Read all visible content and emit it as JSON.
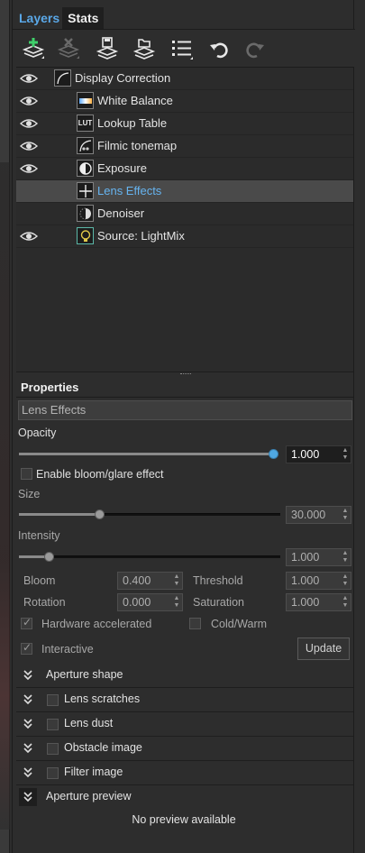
{
  "tabs": [
    {
      "label": "Layers"
    },
    {
      "label": "Stats"
    }
  ],
  "toolbar": {
    "icons": [
      "add-layer-icon",
      "delete-layer-icon",
      "save-icon",
      "open-folder-icon",
      "list-menu-icon",
      "undo-icon",
      "redo-icon"
    ]
  },
  "layers": [
    {
      "name": "Display Correction",
      "visible": true,
      "icon": "curve-icon"
    },
    {
      "name": "White Balance",
      "visible": true,
      "icon": "white-balance-icon"
    },
    {
      "name": "Lookup Table",
      "visible": true,
      "icon": "lut-icon",
      "icon_text": "LUT"
    },
    {
      "name": "Filmic tonemap",
      "visible": true,
      "icon": "filmic-icon"
    },
    {
      "name": "Exposure",
      "visible": true,
      "icon": "exposure-icon"
    },
    {
      "name": "Lens Effects",
      "visible": false,
      "icon": "lens-effects-icon",
      "selected": true
    },
    {
      "name": "Denoiser",
      "visible": false,
      "icon": "denoiser-icon"
    },
    {
      "name": "Source: LightMix",
      "visible": true,
      "icon": "lightmix-icon"
    }
  ],
  "properties": {
    "header": "Properties",
    "layer_name": "Lens Effects",
    "opacity": {
      "label": "Opacity",
      "value": "1.000",
      "fraction": 1.0
    },
    "enable_bloom": {
      "label": "Enable bloom/glare effect",
      "checked": false
    },
    "size": {
      "label": "Size",
      "value": "30.000",
      "fraction": 0.3
    },
    "intensity": {
      "label": "Intensity",
      "value": "1.000",
      "fraction": 0.1
    },
    "bloom": {
      "label": "Bloom",
      "value": "0.400"
    },
    "threshold": {
      "label": "Threshold",
      "value": "1.000"
    },
    "rotation": {
      "label": "Rotation",
      "value": "0.000"
    },
    "saturation": {
      "label": "Saturation",
      "value": "1.000"
    },
    "hardware_accelerated": {
      "label": "Hardware accelerated",
      "checked": true
    },
    "cold_warm": {
      "label": "Cold/Warm",
      "checked": false
    },
    "interactive": {
      "label": "Interactive",
      "checked": true
    },
    "update_button": "Update",
    "sections": [
      {
        "label": "Aperture shape",
        "has_checkbox": false
      },
      {
        "label": "Lens scratches",
        "has_checkbox": true
      },
      {
        "label": "Lens dust",
        "has_checkbox": true
      },
      {
        "label": "Obstacle image",
        "has_checkbox": true
      },
      {
        "label": "Filter image",
        "has_checkbox": true
      },
      {
        "label": "Aperture preview",
        "has_checkbox": false
      }
    ],
    "preview_text": "No preview available"
  },
  "colors": {
    "accent": "#4fa8e3",
    "selected_text": "#66b4f0",
    "panel_bg": "#2d2d2d"
  }
}
